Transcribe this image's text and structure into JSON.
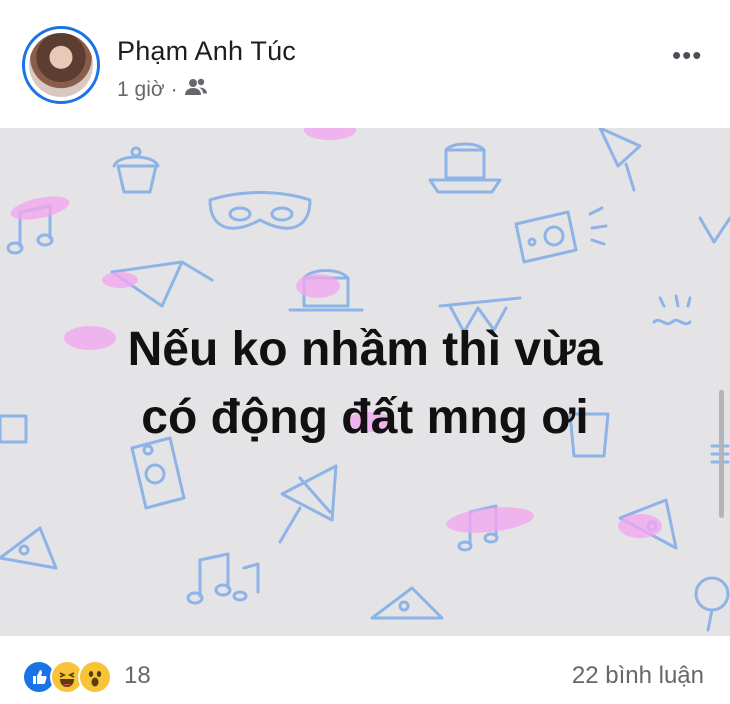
{
  "post": {
    "author_name": "Phạm Anh Túc",
    "timestamp": "1 giờ",
    "separator": "·",
    "privacy_icon": "friends-icon",
    "more_icon": "more-options-icon",
    "more_glyph": "•••",
    "text_line1": "Nếu ko nhầm thì vừa",
    "text_line2": "có động đất mng ơi",
    "background_color": "#e4e4e6"
  },
  "footer": {
    "reactions": [
      "like-icon",
      "haha-icon",
      "wow-icon"
    ],
    "reaction_count": "18",
    "comment_count": "22 bình luận"
  },
  "colors": {
    "accent": "#1b74e4",
    "text": "#1c1e21",
    "muted": "#65676b",
    "pattern_blue": "#8eb3e6",
    "pattern_pink": "#f2a7ef"
  }
}
